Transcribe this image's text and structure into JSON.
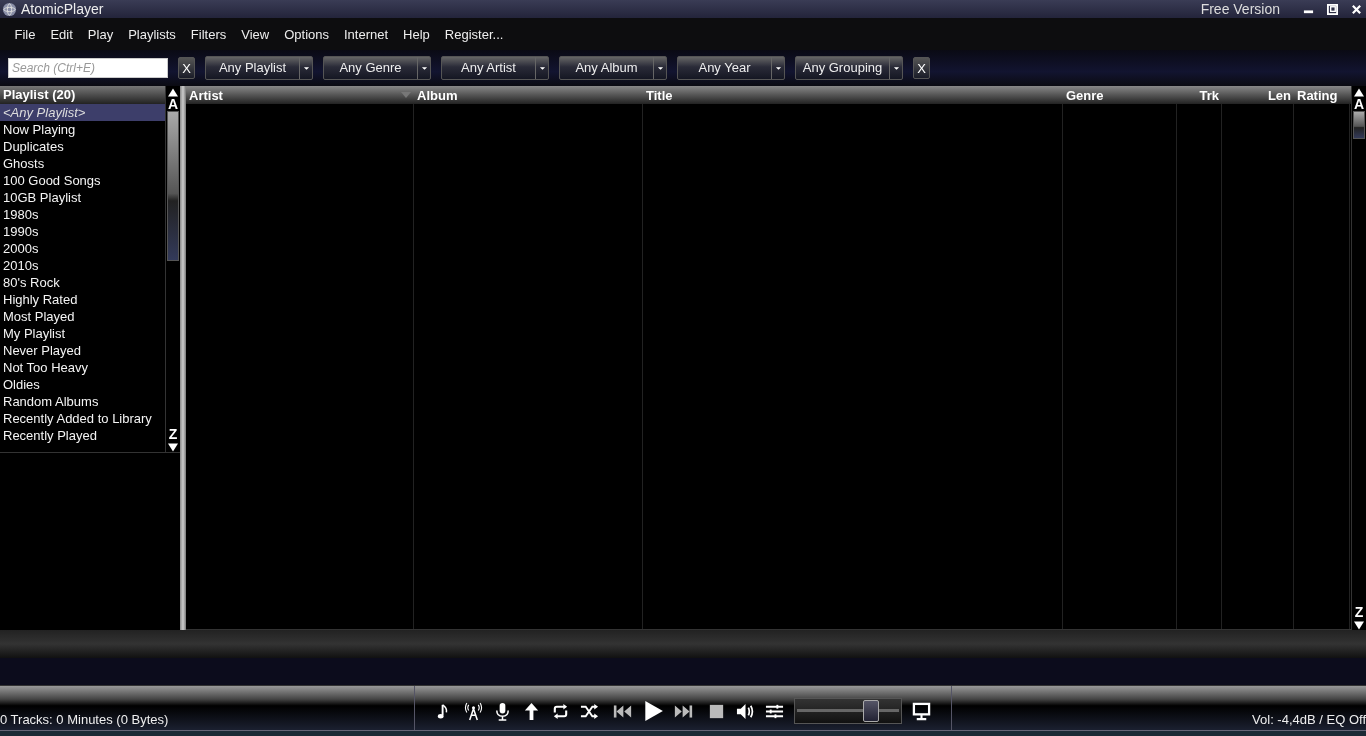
{
  "window": {
    "title": "AtomicPlayer",
    "edition": "Free Version"
  },
  "menu": [
    "File",
    "Edit",
    "Play",
    "Playlists",
    "Filters",
    "View",
    "Options",
    "Internet",
    "Help",
    "Register..."
  ],
  "search": {
    "placeholder": "Search (Ctrl+E)",
    "clear": "X"
  },
  "filters": [
    "Any Playlist",
    "Any Genre",
    "Any Artist",
    "Any Album",
    "Any Year",
    "Any Grouping"
  ],
  "filters_clear": "X",
  "playlists": {
    "header": "Playlist (20)",
    "index_top": "A",
    "index_bottom": "Z",
    "items": [
      {
        "label": "<Any Playlist>",
        "selected": true
      },
      {
        "label": "Now Playing",
        "selected": false
      },
      {
        "label": "Duplicates",
        "selected": false
      },
      {
        "label": "Ghosts",
        "selected": false
      },
      {
        "label": "100 Good Songs",
        "selected": false
      },
      {
        "label": "10GB Playlist",
        "selected": false
      },
      {
        "label": "1980s",
        "selected": false
      },
      {
        "label": "1990s",
        "selected": false
      },
      {
        "label": "2000s",
        "selected": false
      },
      {
        "label": "2010s",
        "selected": false
      },
      {
        "label": "80's Rock",
        "selected": false
      },
      {
        "label": "Highly Rated",
        "selected": false
      },
      {
        "label": "Most Played",
        "selected": false
      },
      {
        "label": "My Playlist",
        "selected": false
      },
      {
        "label": "Never Played",
        "selected": false
      },
      {
        "label": "Not Too Heavy",
        "selected": false
      },
      {
        "label": "Oldies",
        "selected": false
      },
      {
        "label": "Random Albums",
        "selected": false
      },
      {
        "label": "Recently Added to Library",
        "selected": false
      },
      {
        "label": "Recently Played",
        "selected": false
      }
    ]
  },
  "table": {
    "index_top": "A",
    "index_bottom": "Z",
    "columns": [
      {
        "label": "Artist",
        "sorted": true
      },
      {
        "label": "Album",
        "sorted": false
      },
      {
        "label": "Title",
        "sorted": false
      },
      {
        "label": "Genre",
        "sorted": false
      },
      {
        "label": "Trk",
        "sorted": false
      },
      {
        "label": "Len",
        "sorted": false
      },
      {
        "label": "Rating",
        "sorted": false
      }
    ]
  },
  "status": {
    "tracks": "0 Tracks: 0 Minutes (0 Bytes)",
    "volume_text": "Vol: -4,4dB / EQ Off"
  },
  "volume": {
    "level": 0.72
  }
}
